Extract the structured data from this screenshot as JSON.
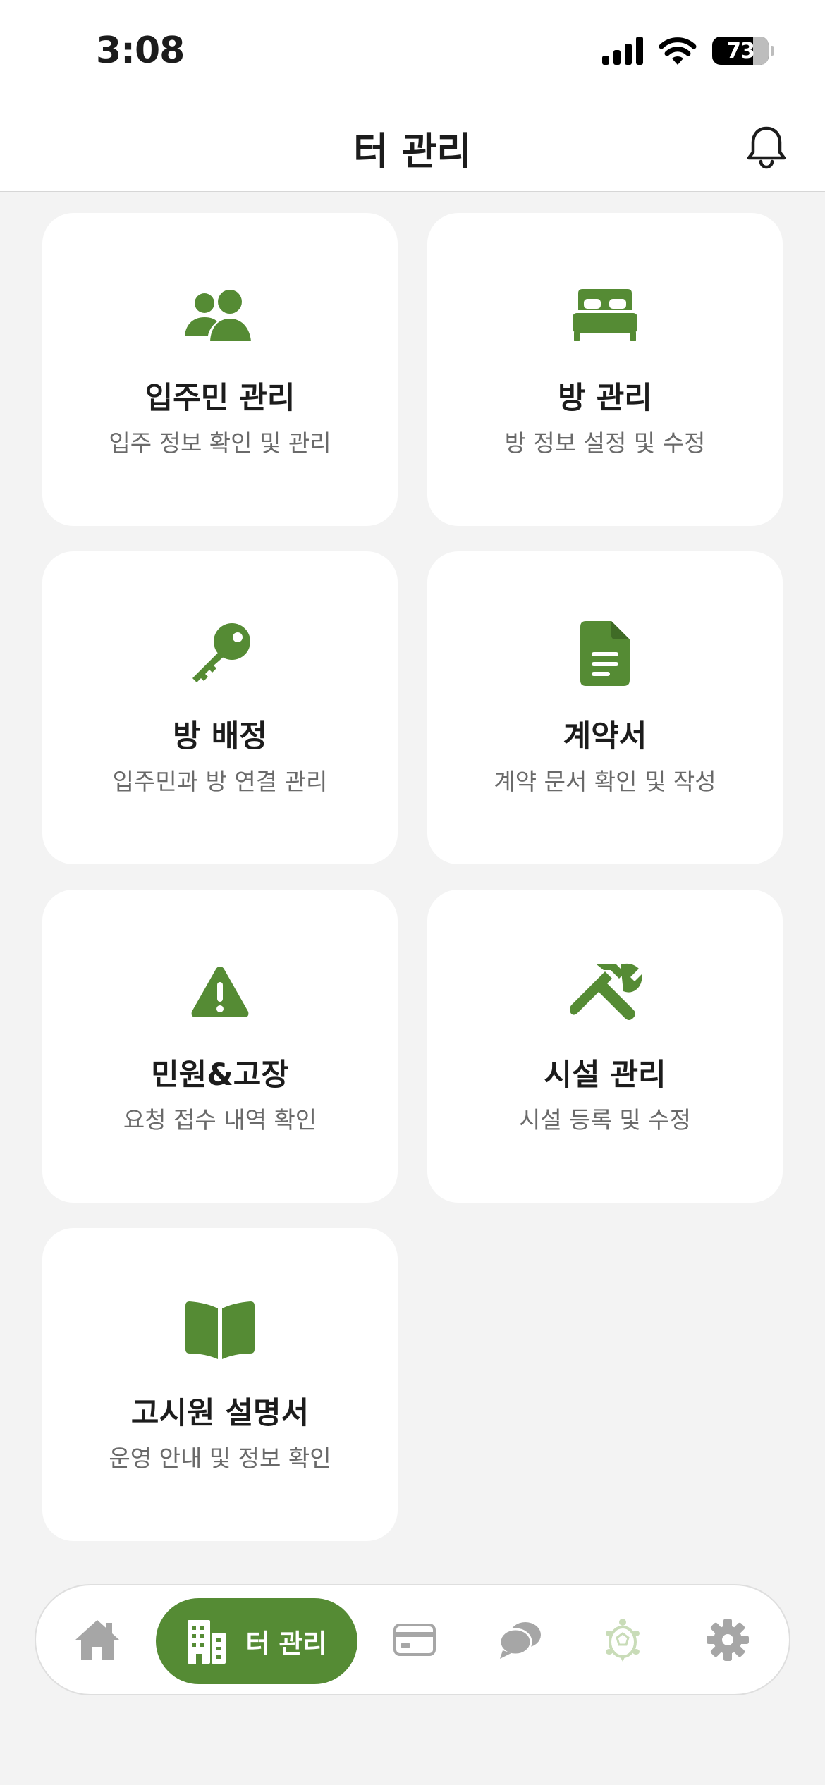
{
  "status_bar": {
    "time": "3:08",
    "battery": "73"
  },
  "header": {
    "title": "터 관리"
  },
  "cards": [
    {
      "icon": "users-icon",
      "title": "입주민 관리",
      "subtitle": "입주 정보 확인 및 관리"
    },
    {
      "icon": "bed-icon",
      "title": "방 관리",
      "subtitle": "방 정보 설정 및 수정"
    },
    {
      "icon": "key-icon",
      "title": "방 배정",
      "subtitle": "입주민과 방 연결 관리"
    },
    {
      "icon": "document-icon",
      "title": "계약서",
      "subtitle": "계약 문서 확인 및 작성"
    },
    {
      "icon": "warning-icon",
      "title": "민원&고장",
      "subtitle": "요청 접수 내역 확인"
    },
    {
      "icon": "tools-icon",
      "title": "시설 관리",
      "subtitle": "시설 등록 및 수정"
    },
    {
      "icon": "book-icon",
      "title": "고시원 설명서",
      "subtitle": "운영 안내 및 정보 확인"
    }
  ],
  "tab_bar": {
    "active_label": "터 관리",
    "items": [
      "home-icon",
      "building-icon",
      "card-icon",
      "chat-icon",
      "turtle-icon",
      "gear-icon"
    ]
  },
  "colors": {
    "accent": "#558b34",
    "background": "#f3f3f3",
    "card": "#ffffff",
    "inactive_icon": "#a6a6a6"
  }
}
